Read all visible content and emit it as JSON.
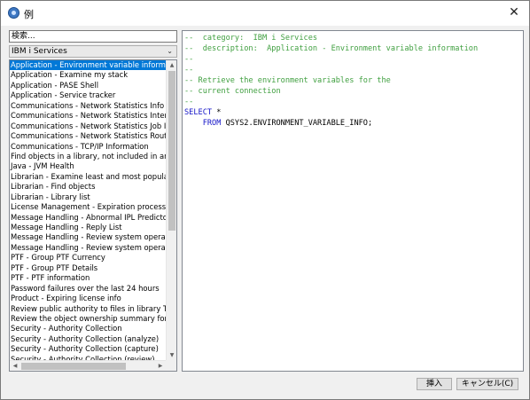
{
  "window": {
    "title": "例",
    "close_glyph": "✕"
  },
  "search": {
    "value": "検索..."
  },
  "category_select": {
    "selected": "IBM i Services",
    "arrow": "⌄"
  },
  "examples": [
    "Application - Environment variable information",
    "Application - Examine my stack",
    "Application - PASE Shell",
    "Application - Service tracker",
    "Communications - Network Statistics Info (N",
    "Communications - Network Statistics Interfa",
    "Communications - Network Statistics Job In",
    "Communications - Network Statistics Route",
    "Communications - TCP/IP Information",
    "Find objects in a library, not included in an au",
    "Java - JVM Health",
    "Librarian - Examine least and most popular r",
    "Librarian - Find objects",
    "Librarian - Library list",
    "License Management - Expiration processing",
    "Message Handling - Abnormal IPL Predictor",
    "Message Handling - Reply List",
    "Message Handling - Review system operator",
    "Message Handling - Review system operator",
    "PTF - Group PTF Currency",
    "PTF - Group PTF Details",
    "PTF - PTF information",
    "Password failures over the last 24 hours",
    "Product - Expiring license info",
    "Review public authority to files in library TOY",
    "Review the object ownership summary for ob",
    "Security - Authority Collection",
    "Security - Authority Collection (analyze)",
    "Security - Authority Collection (capture)",
    "Security - Authority Collection (review)"
  ],
  "selected_index": 0,
  "editor": {
    "lines": [
      {
        "text": "--  category:  IBM i Services",
        "kind": "comment"
      },
      {
        "text": "--  description:  Application - Environment variable information",
        "kind": "comment"
      },
      {
        "text": "--",
        "kind": "comment"
      },
      {
        "text": "--",
        "kind": "comment"
      },
      {
        "text": "-- Retrieve the environment variables for the",
        "kind": "comment"
      },
      {
        "text": "-- current connection",
        "kind": "comment"
      },
      {
        "text": "--",
        "kind": "comment"
      },
      {
        "text": "SELECT *",
        "kind": "select"
      },
      {
        "text": "    FROM QSYS2.ENVIRONMENT_VARIABLE_INFO;",
        "kind": "from"
      }
    ]
  },
  "buttons": {
    "insert": "挿入",
    "cancel": "キャンセル(C)"
  },
  "colors": {
    "selection": "#0078d7",
    "comment": "#3f9f3f",
    "keyword": "#1515c8"
  }
}
